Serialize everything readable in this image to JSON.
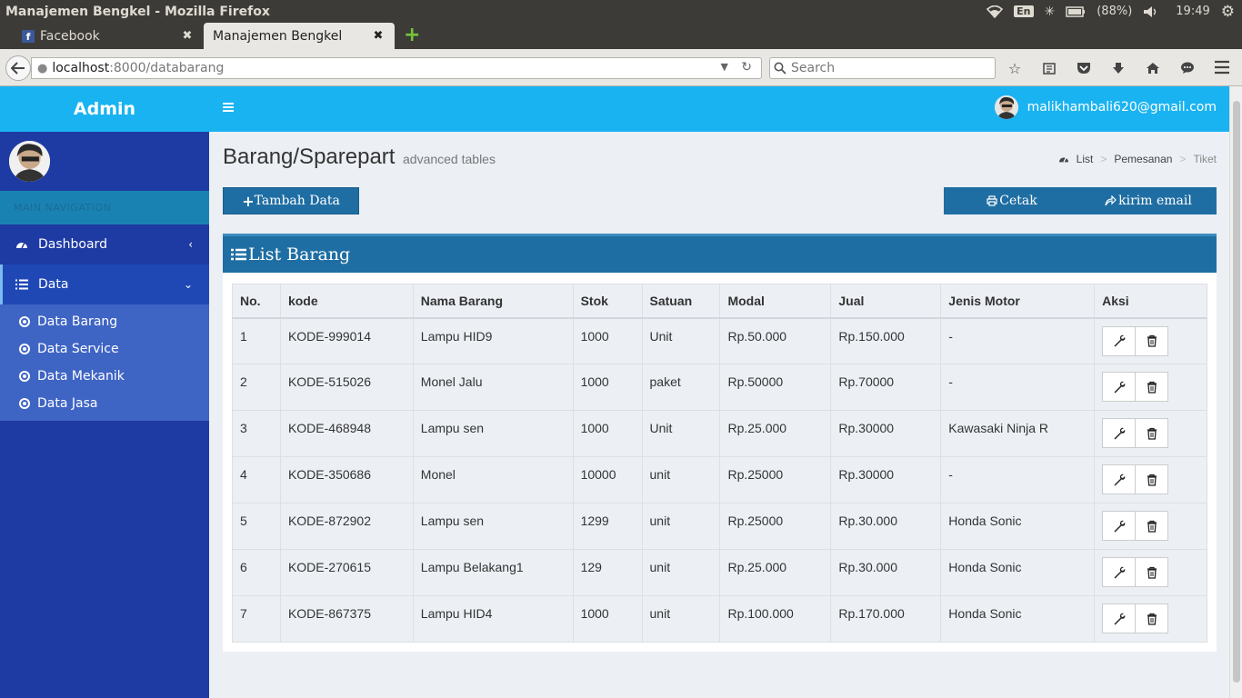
{
  "os": {
    "window_title": "Manajemen Bengkel - Mozilla Firefox",
    "keyboard": "En",
    "battery": "(88%)",
    "time": "19:49"
  },
  "browser": {
    "tabs": [
      {
        "label": "Facebook",
        "favicon": "facebook-icon"
      },
      {
        "label": "Manajemen Bengkel",
        "favicon": "none"
      }
    ],
    "url_host": "localhost",
    "url_path": ":8000/databarang",
    "search_placeholder": "Search"
  },
  "header": {
    "brand": "Admin",
    "user_email": "malikhambali620@gmail.com",
    "accent": "#1ab3f1"
  },
  "sidebar": {
    "section_label": "MAIN NAVIGATION",
    "items": [
      {
        "label": "Dashboard",
        "icon": "dashboard-icon"
      },
      {
        "label": "Data",
        "icon": "list-icon"
      }
    ],
    "subitems": [
      {
        "label": "Data Barang"
      },
      {
        "label": "Data Service"
      },
      {
        "label": "Data Mekanik"
      },
      {
        "label": "Data Jasa"
      }
    ],
    "bg": "#1e3aa3"
  },
  "page": {
    "title": "Barang/Sparepart",
    "subtitle": "advanced tables",
    "breadcrumb": [
      "List",
      "Pemesanan",
      "Tiket"
    ],
    "add_button": "Tambah Data",
    "print_button": "Cetak",
    "email_button": "kirim email",
    "box_title": "List Barang"
  },
  "table": {
    "columns": [
      "No.",
      "kode",
      "Nama Barang",
      "Stok",
      "Satuan",
      "Modal",
      "Jual",
      "Jenis Motor",
      "Aksi"
    ],
    "rows": [
      [
        "1",
        "KODE-999014",
        "Lampu HID9",
        "1000",
        "Unit",
        "Rp.50.000",
        "Rp.150.000",
        "-"
      ],
      [
        "2",
        "KODE-515026",
        "Monel Jalu",
        "1000",
        "paket",
        "Rp.50000",
        "Rp.70000",
        "-"
      ],
      [
        "3",
        "KODE-468948",
        "Lampu sen",
        "1000",
        "Unit",
        "Rp.25.000",
        "Rp.30000",
        "Kawasaki Ninja R"
      ],
      [
        "4",
        "KODE-350686",
        "Monel",
        "10000",
        "unit",
        "Rp.25000",
        "Rp.30000",
        "-"
      ],
      [
        "5",
        "KODE-872902",
        "Lampu sen",
        "1299",
        "unit",
        "Rp.25000",
        "Rp.30.000",
        "Honda Sonic"
      ],
      [
        "6",
        "KODE-270615",
        "Lampu Belakang1",
        "129",
        "unit",
        "Rp.25.000",
        "Rp.30.000",
        "Honda Sonic"
      ],
      [
        "7",
        "KODE-867375",
        "Lampu HID4",
        "1000",
        "unit",
        "Rp.100.000",
        "Rp.170.000",
        "Honda Sonic"
      ]
    ]
  }
}
